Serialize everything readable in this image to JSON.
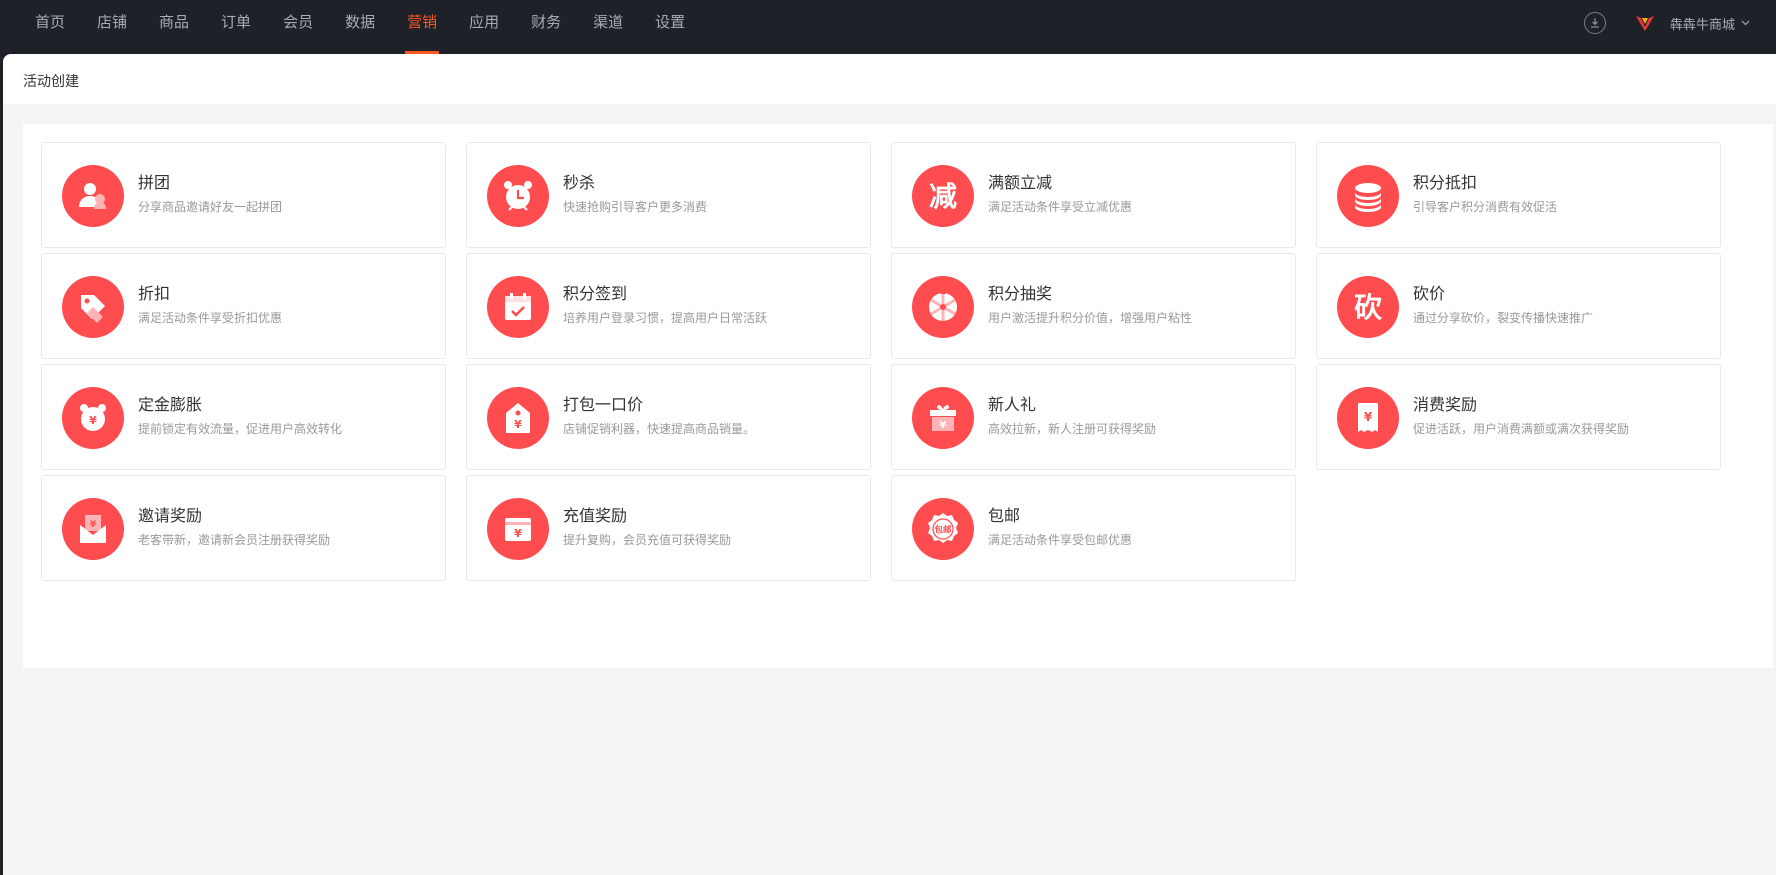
{
  "nav": {
    "items": [
      {
        "label": "首页"
      },
      {
        "label": "店铺"
      },
      {
        "label": "商品"
      },
      {
        "label": "订单"
      },
      {
        "label": "会员"
      },
      {
        "label": "数据"
      },
      {
        "label": "营销"
      },
      {
        "label": "应用"
      },
      {
        "label": "财务"
      },
      {
        "label": "渠道"
      },
      {
        "label": "设置"
      }
    ],
    "active": "营销"
  },
  "header": {
    "download_icon": "download-icon",
    "logo_icon": "brand-logo",
    "store_name": "犇犇牛商城",
    "dropdown_icon": "chevron-down-icon"
  },
  "page": {
    "title": "活动创建"
  },
  "colors": {
    "accent": "#ff5722",
    "icon_bg": "#ff4c4e",
    "topbar_bg": "#1f2129"
  },
  "activities": [
    {
      "title": "拼团",
      "desc": "分享商品邀请好友一起拼团",
      "icon": "group-buy-icon"
    },
    {
      "title": "秒杀",
      "desc": "快速抢购引导客户更多消费",
      "icon": "alarm-clock-icon"
    },
    {
      "title": "满额立减",
      "desc": "满足活动条件享受立减优惠",
      "icon": "reduce-icon"
    },
    {
      "title": "积分抵扣",
      "desc": "引导客户积分消费有效促活",
      "icon": "coin-stack-icon"
    },
    {
      "title": "折扣",
      "desc": "满足活动条件享受折扣优惠",
      "icon": "discount-tag-icon"
    },
    {
      "title": "积分签到",
      "desc": "培养用户登录习惯，提高用户日常活跃",
      "icon": "calendar-check-icon"
    },
    {
      "title": "积分抽奖",
      "desc": "用户激活提升积分价值，增强用户粘性",
      "icon": "lottery-wheel-icon"
    },
    {
      "title": "砍价",
      "desc": "通过分享砍价，裂变传播快速推广",
      "icon": "bargain-icon"
    },
    {
      "title": "定金膨胀",
      "desc": "提前锁定有效流量，促进用户高效转化",
      "icon": "deposit-clock-icon"
    },
    {
      "title": "打包一口价",
      "desc": "店铺促销利器，快速提高商品销量。",
      "icon": "price-tag-icon"
    },
    {
      "title": "新人礼",
      "desc": "高效拉新，新人注册可获得奖励",
      "icon": "gift-box-icon"
    },
    {
      "title": "消费奖励",
      "desc": "促进活跃，用户消费满额或满次获得奖励",
      "icon": "receipt-icon"
    },
    {
      "title": "邀请奖励",
      "desc": "老客带新，邀请新会员注册获得奖励",
      "icon": "envelope-icon"
    },
    {
      "title": "充值奖励",
      "desc": "提升复购，会员充值可获得奖励",
      "icon": "wallet-icon"
    },
    {
      "title": "包邮",
      "desc": "满足活动条件享受包邮优惠",
      "icon": "free-shipping-icon"
    }
  ],
  "icon_text": {
    "reduce": "减",
    "bargain": "砍",
    "free_shipping": "包邮",
    "yuan": "¥"
  }
}
